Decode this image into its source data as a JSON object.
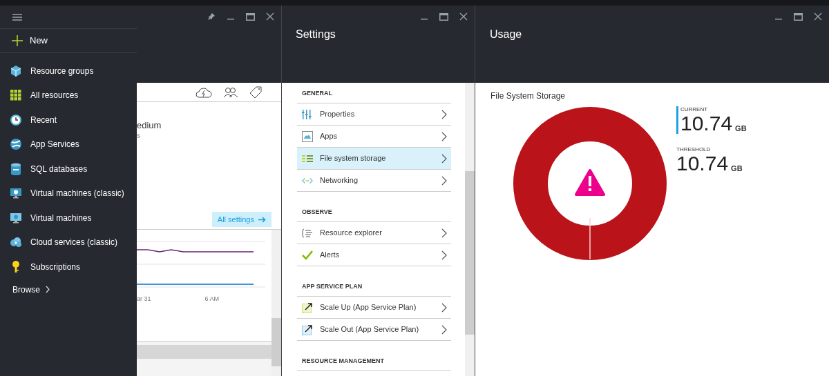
{
  "sidebar": {
    "new_label": "New",
    "items": [
      {
        "label": "Resource groups"
      },
      {
        "label": "All resources"
      },
      {
        "label": "Recent"
      },
      {
        "label": "App Services"
      },
      {
        "label": "SQL databases"
      },
      {
        "label": "Virtual machines (classic)"
      },
      {
        "label": "Virtual machines"
      },
      {
        "label": "Cloud services (classic)"
      },
      {
        "label": "Subscriptions"
      }
    ],
    "browse_label": "Browse"
  },
  "resource_blade": {
    "text_1": "edium",
    "text_2": "s",
    "settings_button": "All settings",
    "axis_labels": [
      "ar 31",
      "6 AM"
    ]
  },
  "settings_blade": {
    "title": "Settings",
    "sections": [
      {
        "heading": "GENERAL",
        "items": [
          {
            "label": "Properties",
            "selected": false
          },
          {
            "label": "Apps",
            "selected": false
          },
          {
            "label": "File system storage",
            "selected": true
          },
          {
            "label": "Networking",
            "selected": false
          }
        ]
      },
      {
        "heading": "OBSERVE",
        "items": [
          {
            "label": "Resource explorer",
            "selected": false
          },
          {
            "label": "Alerts",
            "selected": false
          }
        ]
      },
      {
        "heading": "APP SERVICE PLAN",
        "items": [
          {
            "label": "Scale Up (App Service Plan)",
            "selected": false
          },
          {
            "label": "Scale Out (App Service Plan)",
            "selected": false
          }
        ]
      },
      {
        "heading": "RESOURCE MANAGEMENT"
      }
    ]
  },
  "usage_blade": {
    "title": "Usage",
    "chart_title": "File System Storage",
    "level": 1,
    "current": {
      "label": "CURRENT",
      "value": "10.74",
      "unit": "GB"
    },
    "threshold": {
      "label": "THRESHOLD",
      "value": "10.74",
      "unit": "GB"
    }
  }
}
